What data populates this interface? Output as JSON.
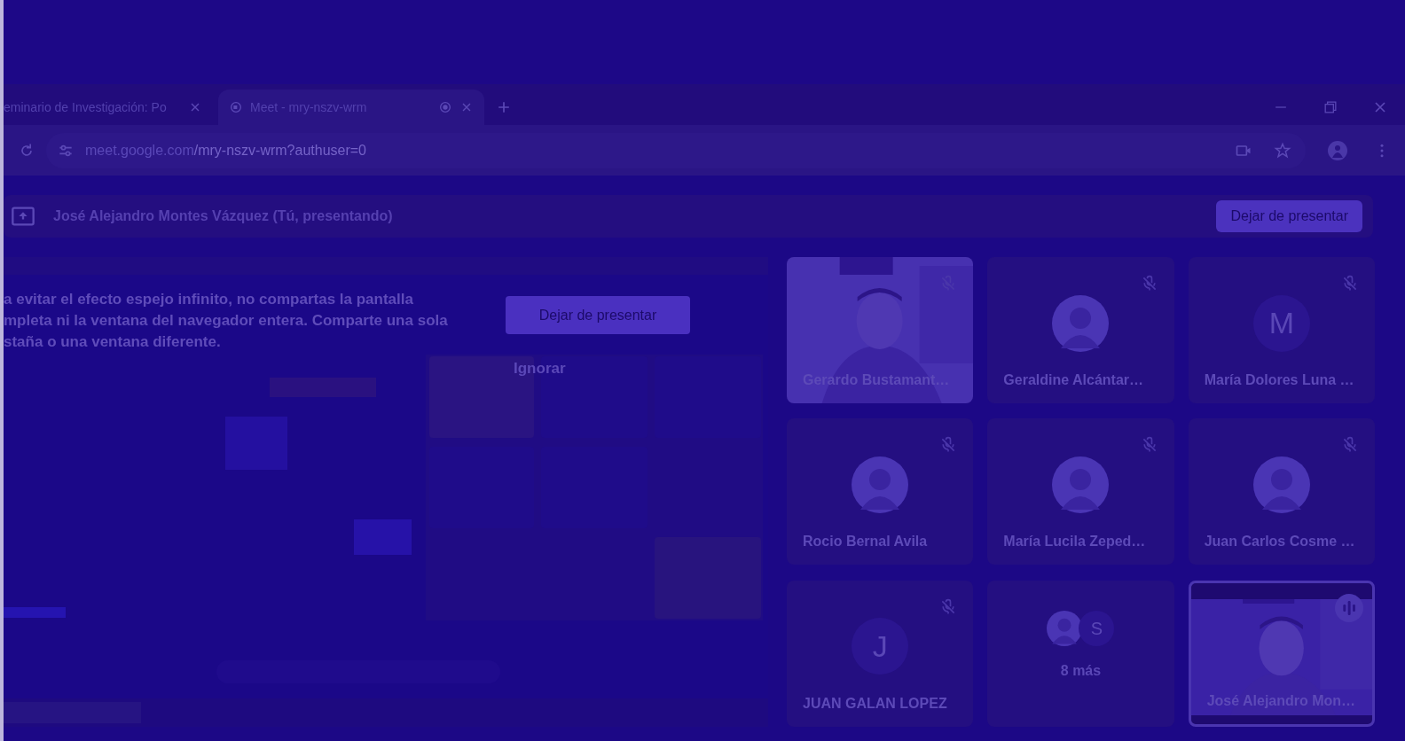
{
  "browser": {
    "tabs": [
      {
        "title": "eminario de Investigación: Po",
        "selected": false,
        "favicon": false,
        "recording": false
      },
      {
        "title": "Meet - mry-nszv-wrm",
        "selected": true,
        "favicon": true,
        "recording": true
      }
    ],
    "url": {
      "domain": "meet.google.com",
      "path": "/mry-nszv-wrm?authuser=0"
    }
  },
  "presenting_bar": {
    "text": "José Alejandro Montes Vázquez (Tú, presentando)",
    "button": "Dejar de presentar"
  },
  "shared_screen": {
    "kind": "picture",
    "notice": "a evitar el efecto espejo infinito, no compartas la pantalla\nmpleta ni la ventana del navegador entera. Comparte una sola\nstaña o una ventana diferente.",
    "button": "Dejar de presentar",
    "dismiss": "Ignorar"
  },
  "tiles": [
    {
      "kind": "video",
      "name": "Gerardo Bustamant…",
      "muted": true,
      "speaking": false
    },
    {
      "kind": "avatar",
      "name": "Geraldine Alcántar…",
      "muted": true,
      "speaking": false
    },
    {
      "kind": "initial",
      "initial": "M",
      "name": "María Dolores Luna …",
      "muted": true,
      "speaking": false
    },
    {
      "kind": "avatar",
      "name": "Rocio Bernal Avila",
      "muted": true,
      "speaking": false
    },
    {
      "kind": "avatar",
      "name": "María Lucila Zeped…",
      "muted": true,
      "speaking": false
    },
    {
      "kind": "avatar",
      "name": "Juan Carlos Cosme …",
      "muted": true,
      "speaking": false
    },
    {
      "kind": "initial",
      "initial": "J",
      "name": "JUAN GALAN LOPEZ",
      "muted": true,
      "speaking": false
    },
    {
      "kind": "more",
      "initial": "S",
      "label": "8 más",
      "muted": false,
      "speaking": false
    },
    {
      "kind": "video",
      "name": "José Alejandro Mon…",
      "muted": false,
      "speaking": true
    }
  ]
}
